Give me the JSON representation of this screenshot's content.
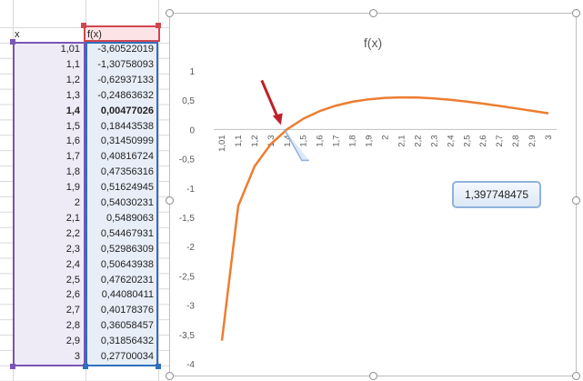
{
  "sheet": {
    "header_x": "x",
    "header_f": "f(x)",
    "rows": [
      {
        "x": "1,01",
        "f": "-3,60522019"
      },
      {
        "x": "1,1",
        "f": "-1,30758093"
      },
      {
        "x": "1,2",
        "f": "-0,62937133"
      },
      {
        "x": "1,3",
        "f": "-0,24863632"
      },
      {
        "x": "1,4",
        "f": "0,00477026"
      },
      {
        "x": "1,5",
        "f": "0,18443538"
      },
      {
        "x": "1,6",
        "f": "0,31450999"
      },
      {
        "x": "1,7",
        "f": "0,40816724"
      },
      {
        "x": "1,8",
        "f": "0,47356316"
      },
      {
        "x": "1,9",
        "f": "0,51624945"
      },
      {
        "x": "2",
        "f": "0,54030231"
      },
      {
        "x": "2,1",
        "f": "0,5489063"
      },
      {
        "x": "2,2",
        "f": "0,54467931"
      },
      {
        "x": "2,3",
        "f": "0,52986309"
      },
      {
        "x": "2,4",
        "f": "0,50643938"
      },
      {
        "x": "2,5",
        "f": "0,47620231"
      },
      {
        "x": "2,6",
        "f": "0,44080411"
      },
      {
        "x": "2,7",
        "f": "0,40178376"
      },
      {
        "x": "2,8",
        "f": "0,36058457"
      },
      {
        "x": "2,9",
        "f": "0,31856432"
      },
      {
        "x": "3",
        "f": "0,27700034"
      }
    ],
    "bold_row": 4,
    "colors": {
      "x_border": "#7a55b5",
      "f_border": "#2f6fbd",
      "header_border": "#d0474f"
    }
  },
  "chart_data": {
    "type": "line",
    "title": "f(x)",
    "categories": [
      "1,01",
      "1,1",
      "1,2",
      "1,3",
      "1,4",
      "1,5",
      "1,6",
      "1,7",
      "1,8",
      "1,9",
      "2",
      "2,1",
      "2,2",
      "2,3",
      "2,4",
      "2,5",
      "2,6",
      "2,7",
      "2,8",
      "2,9",
      "3"
    ],
    "series": [
      {
        "name": "f(x)",
        "values": [
          -3.60522019,
          -1.30758093,
          -0.62937133,
          -0.24863632,
          0.00477026,
          0.18443538,
          0.31450999,
          0.40816724,
          0.47356316,
          0.51624945,
          0.54030231,
          0.5489063,
          0.54467931,
          0.52986309,
          0.50643938,
          0.47620231,
          0.44080411,
          0.40178376,
          0.36058457,
          0.31856432,
          0.27700034
        ],
        "color": "#ed7d31"
      }
    ],
    "ylim": [
      -4,
      1
    ],
    "yticks": [
      "1",
      "0,5",
      "0",
      "-0,5",
      "-1",
      "-1,5",
      "-2",
      "-2,5",
      "-3",
      "-3,5",
      "-4"
    ],
    "grid": false,
    "annotation": {
      "text": "1,397748475",
      "arrow_color": "#c0202a"
    }
  }
}
